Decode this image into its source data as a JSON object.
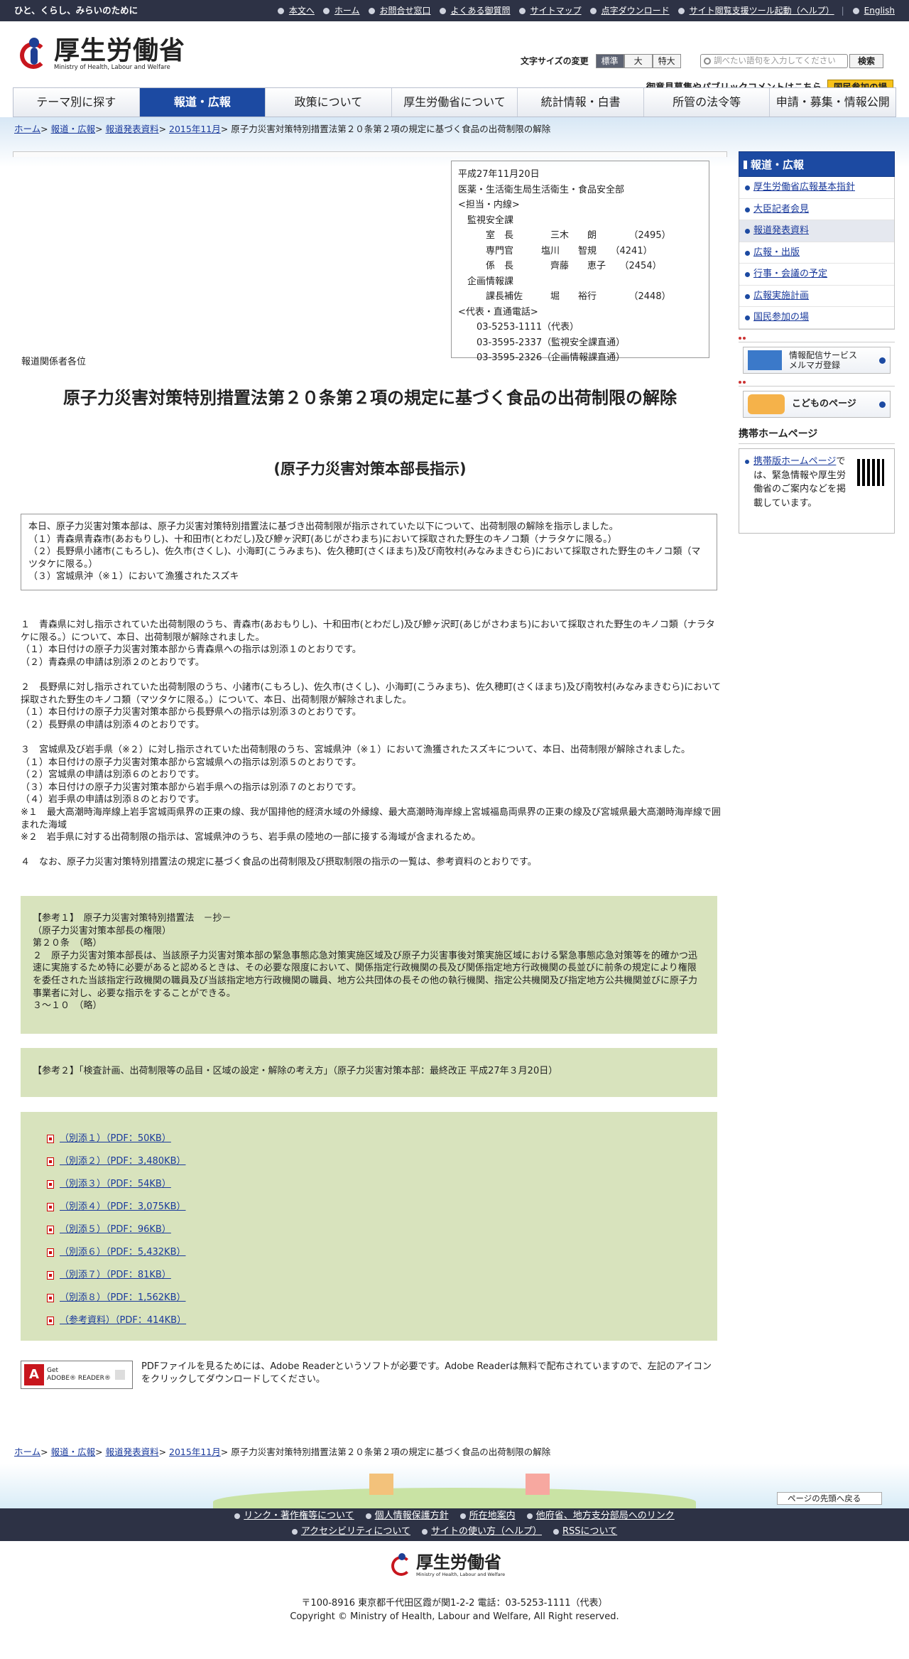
{
  "topbar": {
    "tagline": "ひと、くらし、みらいのために",
    "links": [
      "本文へ",
      "ホーム",
      "お問合せ窓口",
      "よくある御質問",
      "サイトマップ",
      "点字ダウンロード",
      "サイト閲覧支援ツール起動（ヘルプ）"
    ],
    "english": "English"
  },
  "header": {
    "logo_jp": "厚生労働省",
    "logo_en": "Ministry of Health, Labour and Welfare",
    "fontsize_label": "文字サイズの変更",
    "fontsize_options": [
      "標準",
      "大",
      "特大"
    ],
    "search_placeholder": "調べたい語句を入力してください",
    "search_button": "検索",
    "public_comment": "御意見募集やパブリックコメントはこちら",
    "participation": "国民参加の場"
  },
  "gnav": [
    "テーマ別に探す",
    "報道・広報",
    "政策について",
    "厚生労働省について",
    "統計情報・白書",
    "所管の法令等",
    "申請・募集・情報公開"
  ],
  "breadcrumb": [
    "ホーム",
    "報道・広報",
    "報道発表資料",
    "2015年11月"
  ],
  "breadcrumb_current": "原子力災害対策特別措置法第２０条第２項の規定に基づく食品の出荷制限の解除",
  "info": "平成27年11月20日\n医薬・生活衛生局生活衛生・食品安全部\n<担当・内線>\n　監視安全課\n　　　室　長　　　　三木　　朗　　　　（2495）\n　　　専門官　　　塩川　　智規　　（4241）\n　　　係　長　　　　齊藤　　恵子　　（2454）\n　企画情報課\n　　　課長補佐　　　堀　　裕行　　　　（2448）\n<代表・直通電話>\n　　03-5253-1111（代表）\n　　03-3595-2337（監視安全課直通）\n　　03-3595-2326（企画情報課直通）",
  "press_to": "報道関係者各位",
  "title": "原子力災害対策特別措置法第２０条第２項の規定に基づく食品の出荷制限の解除",
  "subtitle": "(原子力災害対策本部長指示)",
  "summary": "本日、原子力災害対策本部は、原子力災害対策特別措置法に基づき出荷制限が指示されていた以下について、出荷制限の解除を指示しました。\n（１）青森県青森市(あおもりし)、十和田市(とわだし)及び鰺ヶ沢町(あじがさわまち)において採取された野生のキノコ類（ナラタケに限る。）\n（２）長野県小諸市(こもろし)、佐久市(さくし)、小海町(こうみまち)、佐久穂町(さくほまち)及び南牧村(みなみまきむら)において採取された野生のキノコ類（マツタケに限る。）\n（３）宮城県沖（※１）において漁獲されたスズキ",
  "paragraphs": [
    "１　青森県に対し指示されていた出荷制限のうち、青森市(あおもりし)、十和田市(とわだし)及び鰺ヶ沢町(あじがさわまち)において採取された野生のキノコ類（ナラタケに限る。）について、本日、出荷制限が解除されました。\n（１）本日付けの原子力災害対策本部から青森県への指示は別添１のとおりです。\n（２）青森県の申請は別添２のとおりです。",
    "２　長野県に対し指示されていた出荷制限のうち、小諸市(こもろし)、佐久市(さくし)、小海町(こうみまち)、佐久穂町(さくほまち)及び南牧村(みなみまきむら)において採取された野生のキノコ類（マツタケに限る。）について、本日、出荷制限が解除されました。\n（１）本日付けの原子力災害対策本部から長野県への指示は別添３のとおりです。\n（２）長野県の申請は別添４のとおりです。",
    "３　宮城県及び岩手県（※２）に対し指示されていた出荷制限のうち、宮城県沖（※１）において漁獲されたスズキについて、本日、出荷制限が解除されました。\n（１）本日付けの原子力災害対策本部から宮城県への指示は別添５のとおりです。\n（２）宮城県の申請は別添６のとおりです。\n（３）本日付けの原子力災害対策本部から岩手県への指示は別添７のとおりです。\n（４）岩手県の申請は別添８のとおりです。\n※１　最大高潮時海岸線上岩手宮城両県界の正東の線、我が国排他的経済水域の外縁線、最大高潮時海岸線上宮城福島両県界の正東の線及び宮城県最大高潮時海岸線で囲まれた海域\n※２　岩手県に対する出荷制限の指示は、宮城県沖のうち、岩手県の陸地の一部に接する海域が含まれるため。",
    "４　なお、原子力災害対策特別措置法の規定に基づく食品の出荷制限及び摂取制限の指示の一覧は、参考資料のとおりです。"
  ],
  "ref1": "【参考１】　原子力災害対策特別措置法　－抄－\n（原子力災害対策本部長の権限）\n第２０条　（略）\n２　原子力災害対策本部長は、当該原子力災害対策本部の緊急事態応急対策実施区域及び原子力災害事後対策実施区域における緊急事態応急対策等を的確かつ迅速に実施するため特に必要があると認めるときは、その必要な限度において、関係指定行政機関の長及び関係指定地方行政機関の長並びに前条の規定により権限を委任された当該指定行政機関の職員及び当該指定地方行政機関の職員、地方公共団体の長その他の執行機関、指定公共機関及び指定地方公共機関並びに原子力事業者に対し、必要な指示をすることができる。\n３～１０　（略）",
  "ref2": "【参考２】「検査計画、出荷制限等の品目・区域の設定・解除の考え方」（原子力災害対策本部：最終改正 平成27年３月20日）",
  "files": [
    "（別添１）（PDF：50KB）",
    "（別添２）（PDF：3,480KB）",
    "（別添３）（PDF：54KB）",
    "（別添４）（PDF：3,075KB）",
    "（別添５）（PDF：96KB）",
    "（別添６）（PDF：5,432KB）",
    "（別添７）（PDF：81KB）",
    "（別添８）（PDF：1,562KB）",
    "（参考資料）（PDF：414KB）"
  ],
  "adobe": {
    "badge_top": "Get",
    "badge_bottom": "ADOBE® READER®",
    "message": "PDFファイルを見るためには、Adobe Readerというソフトが必要です。Adobe Readerは無料で配布されていますので、左記のアイコンをクリックしてダウンロードしてください。"
  },
  "sidebar": {
    "heading": "報道・広報",
    "items": [
      "厚生労働省広報基本指針",
      "大臣記者会見",
      "報道発表資料",
      "広報・出版",
      "行事・会議の予定",
      "広報実施計画",
      "国民参加の場"
    ],
    "mailmag_line1": "情報配信サービス",
    "mailmag_line2": "メルマガ登録",
    "kids": "こどものページ",
    "mobile_heading": "携帯ホームページ",
    "mobile_link": "携帯版ホームページ",
    "mobile_text": "では、緊急情報や厚生労働省のご案内などを掲載しています。"
  },
  "footer": {
    "pagetop": "ページの先頭へ戻る",
    "links_row1": [
      "リンク・著作権等について",
      "個人情報保護方針",
      "所在地案内",
      "他府省、地方支分部局へのリンク"
    ],
    "links_row2": [
      "アクセシビリティについて",
      "サイトの使い方（ヘルプ）",
      "RSSについて"
    ],
    "logo_jp": "厚生労働省",
    "logo_en": "Ministry of Health, Labour and Welfare",
    "address": "〒100-8916 東京都千代田区霞が関1-2-2 電話：03-5253-1111（代表）",
    "copyright": "Copyright © Ministry of Health, Labour and Welfare, All Right reserved."
  }
}
